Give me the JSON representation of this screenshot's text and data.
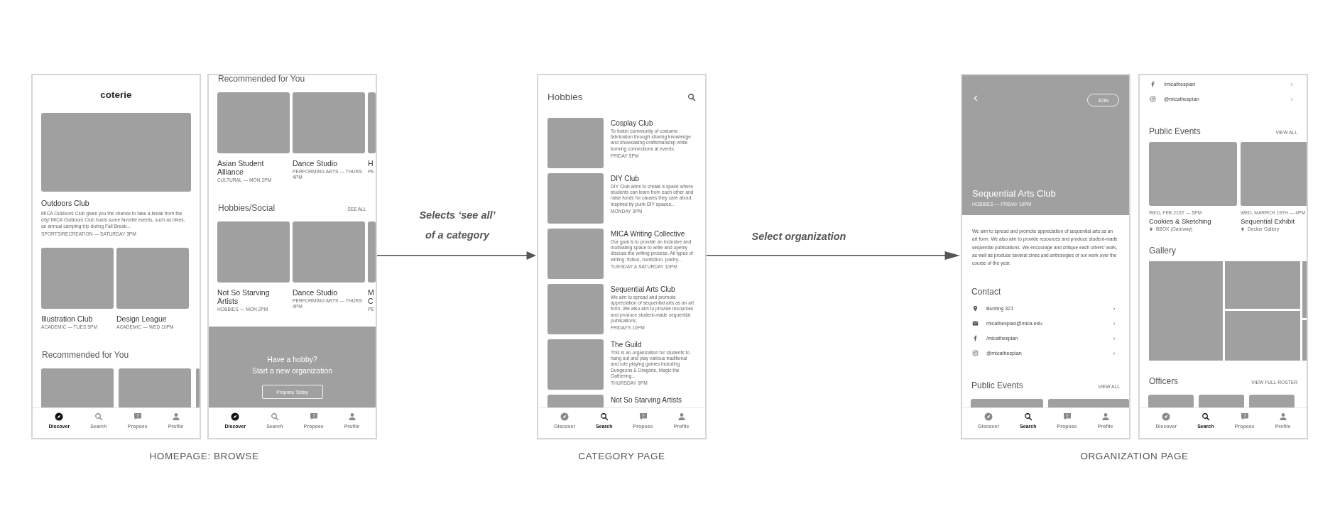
{
  "groups": [
    {
      "caption": "HOMEPAGE: BROWSE",
      "screens": [
        {
          "blocks": [
            {
              "kind": "app_title",
              "text": "coterie"
            },
            {
              "kind": "featured",
              "name": "Outdoors Club",
              "description": "MICA Outdoors Club gives you the chance to take a break from the city! MICA Outdoors Club hosts some favorite events, such as hikes, an annual camping trip during Fall Break...",
              "meta": "SPORTS/RECREATION — SATURDAY 3PM"
            },
            {
              "kind": "card_row",
              "cards": [
                {
                  "kind": "card",
                  "name": "Illustration Club",
                  "meta": "ACADEMIC — TUES 5PM"
                },
                {
                  "kind": "card",
                  "name": "Design League",
                  "meta": "ACADEMIC — WED 10PM"
                }
              ]
            },
            {
              "kind": "section_header",
              "title": "Recommended for You"
            },
            {
              "kind": "card_row",
              "cards": [
                {
                  "kind": "picture"
                },
                {
                  "kind": "picture"
                },
                {
                  "kind": "peek"
                }
              ]
            }
          ],
          "nav": [
            {
              "label": "Discover",
              "selected": true
            },
            {
              "label": "Search",
              "selected": false
            },
            {
              "label": "Propose",
              "selected": false
            },
            {
              "label": "Profile",
              "selected": false
            }
          ]
        },
        {
          "blocks": [
            {
              "kind": "section_header",
              "title": "Recommended for You"
            },
            {
              "kind": "card_row",
              "cards": [
                {
                  "kind": "card",
                  "name": "Asian Student Alliance",
                  "meta": "CULTURAL — MON 2PM"
                },
                {
                  "kind": "card",
                  "name": "Dance Studio",
                  "meta": "PERFORMING ARTS — THURS 4PM"
                },
                {
                  "kind": "peek",
                  "name": "H",
                  "meta": "PE"
                }
              ]
            },
            {
              "kind": "section_header",
              "title": "Hobbies/Social",
              "action": "SEE ALL"
            },
            {
              "kind": "card_row",
              "cards": [
                {
                  "kind": "card",
                  "name": "Not So Starving Artists",
                  "meta": "HOBBIES — MON 2PM"
                },
                {
                  "kind": "card",
                  "name": "Dance Studio",
                  "meta": "PERFORMING ARTS — THURS 4PM"
                },
                {
                  "kind": "peek",
                  "name": "M C",
                  "meta": "PE"
                }
              ]
            },
            {
              "kind": "promo",
              "lines": [
                "Have a hobby?",
                "Start a new organization"
              ],
              "button": "Propose Today"
            }
          ],
          "nav": [
            {
              "label": "Discover",
              "selected": true
            },
            {
              "label": "Search",
              "selected": false
            },
            {
              "label": "Propose",
              "selected": false
            },
            {
              "label": "Profile",
              "selected": false
            }
          ]
        }
      ]
    },
    {
      "caption": "CATEGORY PAGE",
      "screens": [
        {
          "blocks": [
            {
              "kind": "page_header",
              "title": "Hobbies"
            },
            {
              "kind": "list_item",
              "name": "Cosplay Club",
              "description": "To foster community of costume fabrication through sharing knowledge and showcasing craftsmanship while forming connections at events.",
              "meta": "FRIDAY 5PM"
            },
            {
              "kind": "list_item",
              "name": "DIY Club",
              "description": "DIY Club aims to create a space where students can learn from each other and raise funds for causes they care about. Inspired by punk DIY spaces...",
              "meta": "MONDAY 3PM"
            },
            {
              "kind": "list_item",
              "name": "MICA Writing Collective",
              "description": "Our goal is to provide an inclusive and motivating space to write and openly discuss the writing process. All types of writing: fiction, nonfiction, poetry...",
              "meta": "TUESDAY & SATURDAY 10PM"
            },
            {
              "kind": "list_item",
              "name": "Sequential Arts Club",
              "description": "We aim to spread and promote appreciation of sequential arts as an art form. We also aim to provide resources and produce student-made sequential publications.",
              "meta": "FRIDAYS 10PM"
            },
            {
              "kind": "list_item",
              "name": "The Guild",
              "description": "This is an organization for students to hang out and play various traditional and role playing games including Dungeons & Dragons, Magic the Gathering...",
              "meta": "THURSDAY 9PM"
            },
            {
              "kind": "list_item",
              "name": "Not So Starving Artists"
            }
          ],
          "nav": [
            {
              "label": "Discover",
              "selected": false
            },
            {
              "label": "Search",
              "selected": true
            },
            {
              "label": "Propose",
              "selected": false
            },
            {
              "label": "Profile",
              "selected": false
            }
          ]
        }
      ]
    },
    {
      "caption": "ORGANIZATION PAGE",
      "screens": [
        {
          "blocks": [
            {
              "kind": "org_header",
              "title": "Sequential Arts Club",
              "meta": "HOBBIES — FRIDAY 10PM",
              "button": "JOIN"
            },
            {
              "kind": "paragraph",
              "text": "We aim to spread and promote appreciation of sequential arts as an art form. We also aim to provide resources and produce student-made sequential publications. We encourage and critique each others’ work, as well as produce several zines and anthologies of our work over the course of the year."
            },
            {
              "kind": "section_header",
              "title": "Contact"
            },
            {
              "kind": "contact_list",
              "items": [
                {
                  "kind": "address",
                  "text": "Bunting 321"
                },
                {
                  "kind": "email",
                  "text": "micathespian@mica.edu"
                },
                {
                  "kind": "facebook",
                  "text": "/micathespian"
                },
                {
                  "kind": "instagram",
                  "text": "@micathespian"
                }
              ]
            },
            {
              "kind": "section_header",
              "title": "Public Events",
              "action": "VIEW ALL"
            },
            {
              "kind": "card_row",
              "cards": [
                {
                  "kind": "picture"
                },
                {
                  "kind": "peek"
                }
              ]
            }
          ],
          "nav": [
            {
              "label": "Discover",
              "selected": false
            },
            {
              "label": "Search",
              "selected": true
            },
            {
              "label": "Propose",
              "selected": false
            },
            {
              "label": "Profile",
              "selected": false
            }
          ]
        },
        {
          "blocks": [
            {
              "kind": "contact_list",
              "items": [
                {
                  "kind": "facebook",
                  "text": "/micathespian"
                },
                {
                  "kind": "instagram",
                  "text": "@micathespian"
                }
              ]
            },
            {
              "kind": "section_header",
              "title": "Public Events",
              "action": "VIEW ALL"
            },
            {
              "kind": "event_row",
              "events": [
                {
                  "date": "WED, FEB 21ST — 5PM",
                  "name": "Cookies & Sketching",
                  "place": "BBOX (Gateway)"
                },
                {
                  "date": "WED, MARRCH 19TH — 4PM",
                  "name": "Sequential Exhibit",
                  "place": "Decker Gallery"
                }
              ]
            },
            {
              "kind": "section_header",
              "title": "Gallery"
            },
            {
              "kind": "gallery"
            },
            {
              "kind": "section_header",
              "title": "Officers",
              "action": "VIEW FULL ROSTER"
            },
            {
              "kind": "card_row",
              "cards": [
                {
                  "kind": "thumb"
                },
                {
                  "kind": "thumb"
                },
                {
                  "kind": "thumb"
                }
              ]
            }
          ],
          "nav": [
            {
              "label": "Discover",
              "selected": false
            },
            {
              "label": "Search",
              "selected": true
            },
            {
              "label": "Propose",
              "selected": false
            },
            {
              "label": "Profile",
              "selected": false
            }
          ]
        }
      ]
    }
  ],
  "arrows": [
    {
      "label": [
        "Selects ‘see all’",
        "of a category"
      ]
    },
    {
      "label": [
        "Select organization"
      ]
    }
  ]
}
